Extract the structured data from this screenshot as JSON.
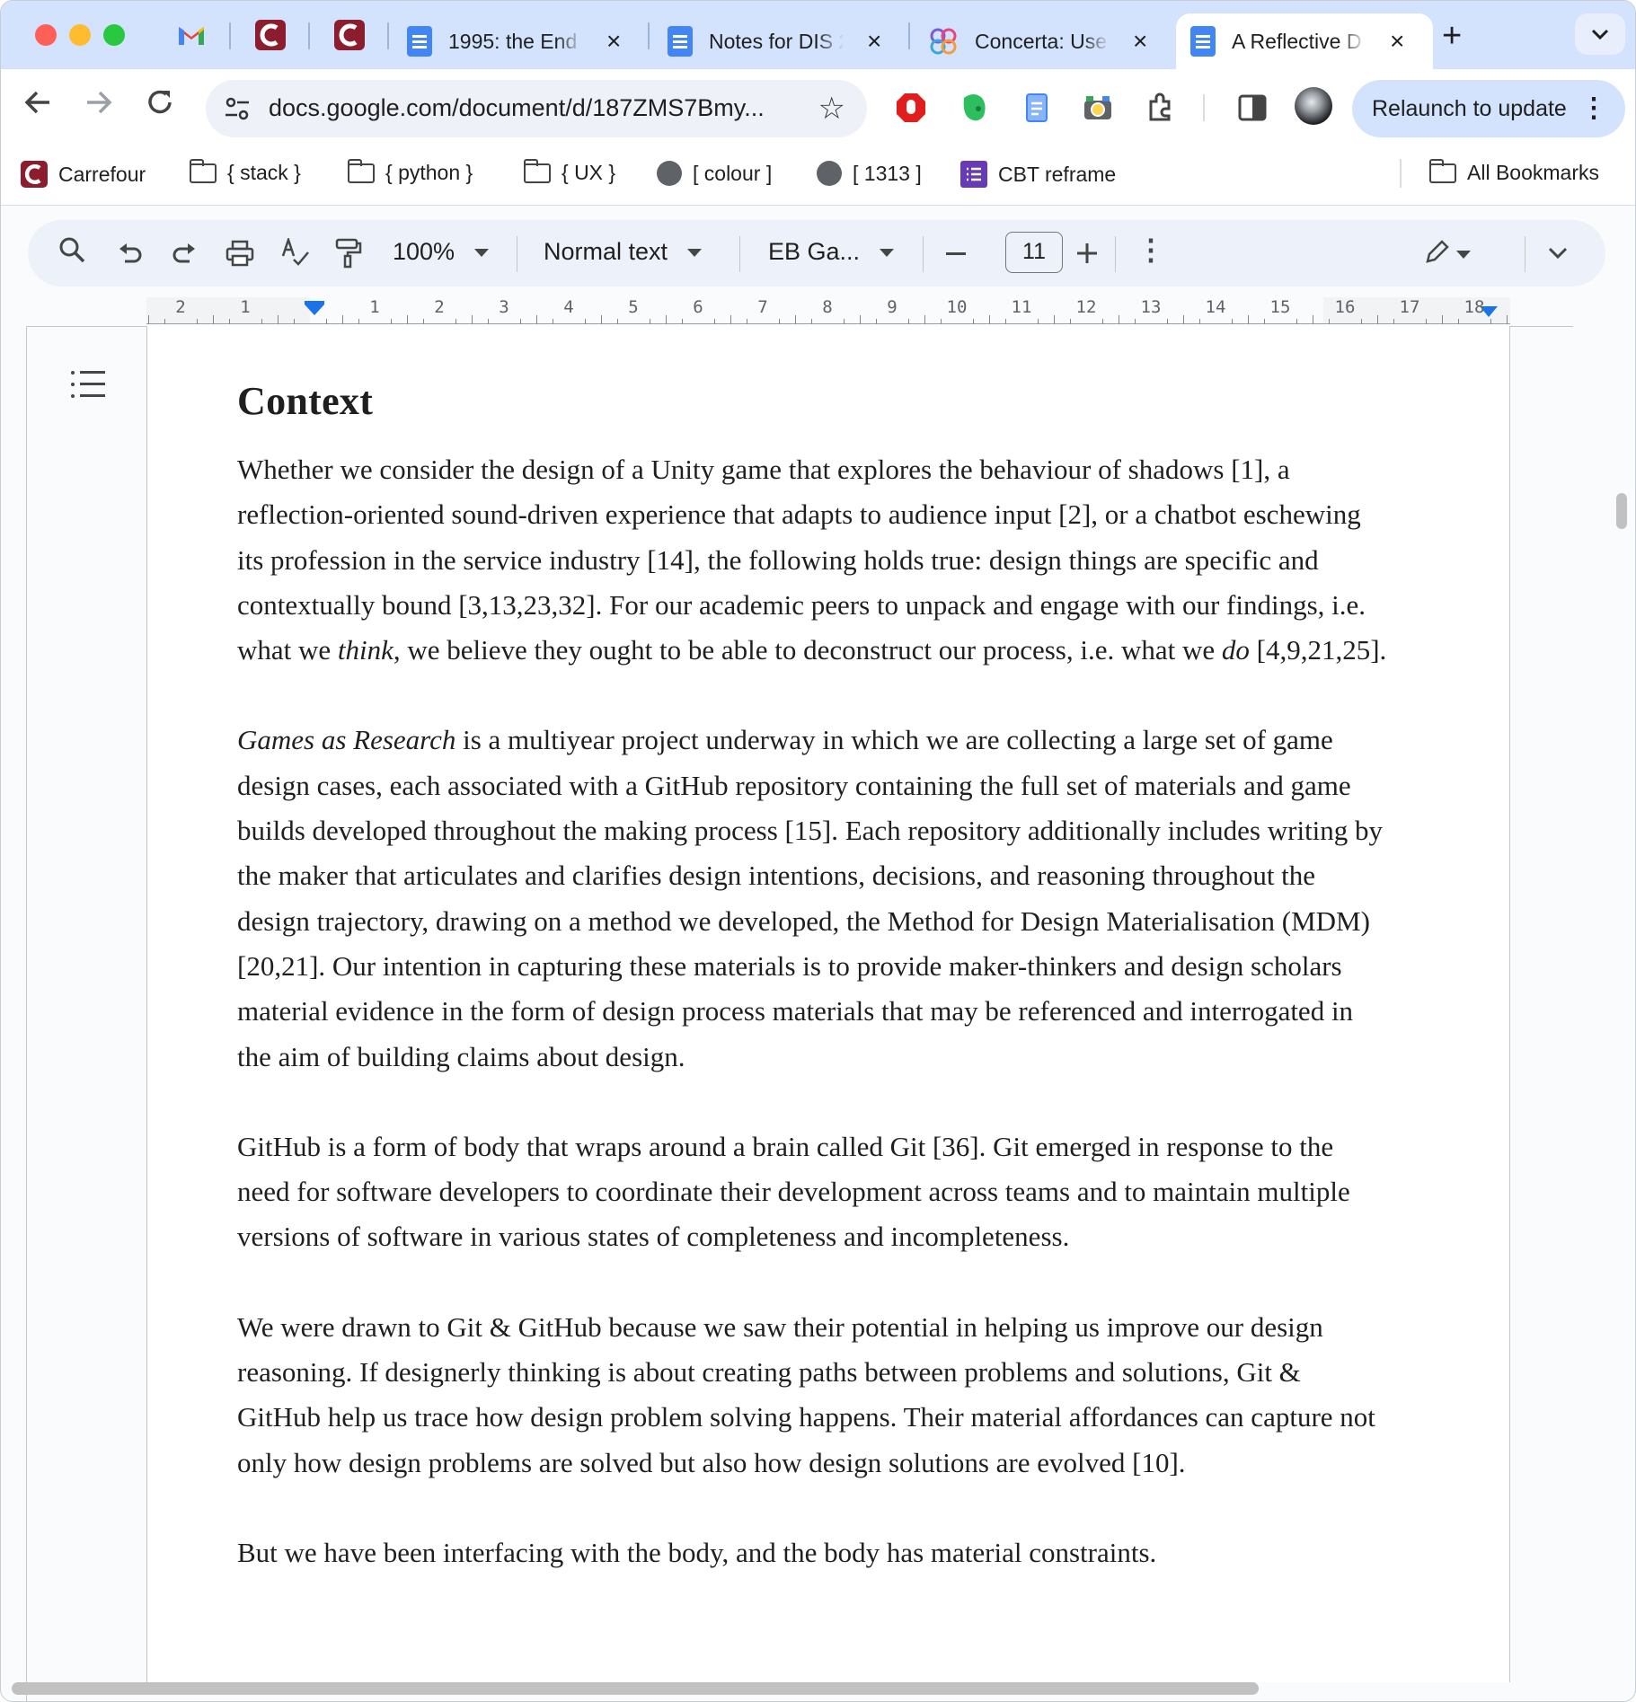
{
  "browser": {
    "tabs": [
      {
        "label": "1995: the End"
      },
      {
        "label": "Notes for DIS 2"
      },
      {
        "label": "Concerta: Use"
      },
      {
        "label": "A Reflective D"
      }
    ],
    "url": "docs.google.com/document/d/187ZMS7Bmy...",
    "relaunch_label": "Relaunch to update",
    "bookmarks": [
      {
        "label": "Carrefour"
      },
      {
        "label": "{ stack }"
      },
      {
        "label": "{ python }"
      },
      {
        "label": "{ UX }"
      },
      {
        "label": "[ colour ]"
      },
      {
        "label": "[ 1313 ]"
      },
      {
        "label": "CBT reframe"
      },
      {
        "label": "All Bookmarks"
      }
    ]
  },
  "docs_toolbar": {
    "zoom": "100%",
    "style": "Normal text",
    "font": "EB Ga...",
    "font_size": "11"
  },
  "ruler": {
    "left_labels": [
      "2",
      "1"
    ],
    "labels": [
      "1",
      "2",
      "3",
      "4",
      "5",
      "6",
      "7",
      "8",
      "9",
      "10",
      "11",
      "12",
      "13",
      "14",
      "15",
      "16",
      "17",
      "18"
    ]
  },
  "document": {
    "heading": "Context",
    "p1": {
      "a": "Whether we consider the design of a Unity game that explores the behaviour of shadows [1], a reflection-oriented sound-driven experience that adapts to audience input [2], or a chatbot eschewing its profession in the service industry [14], the following holds true: design things are specific and contextually bound [3,13,23,32]. For our academic peers to unpack and engage with our findings, i.e. what we ",
      "b": "think",
      "c": ", we believe they ought to be able to deconstruct our process, i.e. what we ",
      "d": "do",
      "e": " [4,9,21,25]."
    },
    "p2": {
      "a": "Games as Research",
      "b": " is a multiyear project underway in which we are collecting a large set of game design cases, each associated with a GitHub repository containing the full set of materials and game builds developed throughout the making process [15]. Each repository additionally includes writing by the maker that articulates and clarifies design intentions, decisions, and reasoning throughout the design trajectory, drawing on a method we developed, the Method for Design Materialisation (MDM) [20,21]. Our intention in capturing these materials is to provide maker-thinkers and design scholars material evidence in the form of design process materials that may be referenced and interrogated in the aim of building claims about design."
    },
    "p3": "GitHub is a form of body that wraps around a brain called Git [36]. Git emerged in response to the need for software developers to coordinate their development across teams and to maintain multiple versions of software in various states of completeness and incompleteness.",
    "p4": "We were drawn to Git & GitHub because we saw their potential in helping us  improve our design reasoning. If designerly thinking is about creating paths between problems and solutions, Git & GitHub help us trace how design problem solving happens. Their material affordances can capture not only how design problems are solved but also how design solutions are evolved [10].",
    "p5": "But we have been interfacing with the body, and the body has material constraints."
  }
}
